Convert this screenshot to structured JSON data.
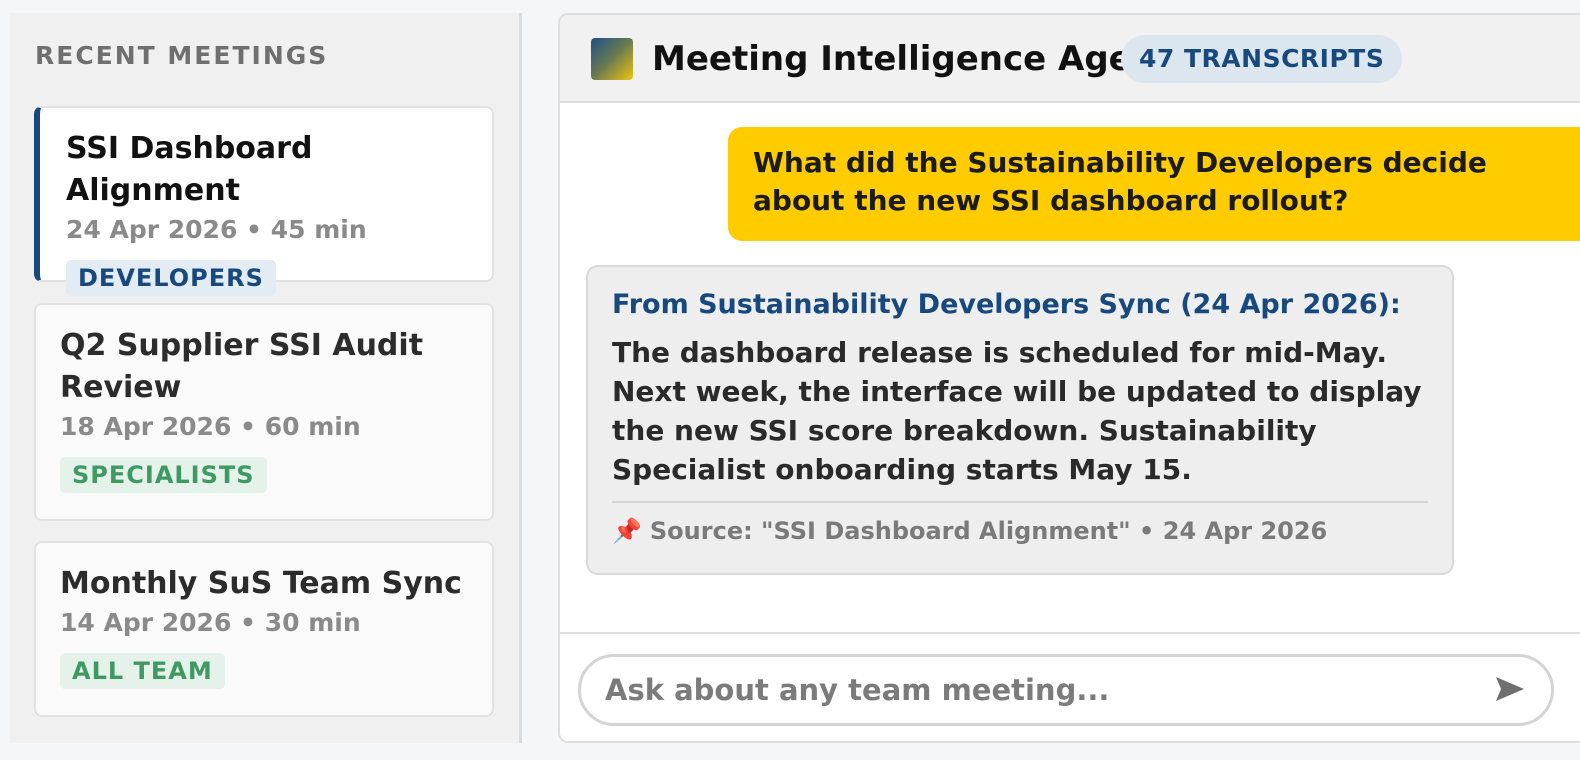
{
  "sidebar": {
    "title": "RECENT MEETINGS",
    "meetings": [
      {
        "title": "SSI Dashboard Alignment",
        "meta": "24 Apr 2026 • 45 min",
        "tag": "DEVELOPERS",
        "active": true
      },
      {
        "title": "Q2 Supplier SSI Audit Review",
        "meta": "18 Apr 2026 • 60 min",
        "tag": "SPECIALISTS",
        "active": false
      },
      {
        "title": "Monthly SuS Team Sync",
        "meta": "14 Apr 2026 • 30 min",
        "tag": "ALL TEAM",
        "active": false
      }
    ]
  },
  "header": {
    "title": "Meeting Intelligence Agent",
    "badge": "47 TRANSCRIPTS",
    "logo_colors": [
      "#1e4f86",
      "#f1c40f"
    ]
  },
  "chat": {
    "user_message": "What did the Sustainability Developers decide about the new SSI dashboard rollout?",
    "answer": {
      "source_heading": "From Sustainability Developers Sync (24 Apr 2026):",
      "body": "The dashboard release is scheduled for mid-May. Next week, the interface will be updated to display the new SSI score breakdown. Sustainability Specialist onboarding starts May 15.",
      "citation_icon": "pin-icon",
      "citation": "Source: \"SSI Dashboard Alignment\" • 24 Apr 2026"
    }
  },
  "input": {
    "placeholder": "Ask about any team meeting...",
    "value": "",
    "send_icon": "send-icon"
  },
  "colors": {
    "accent_blue": "#17497e",
    "accent_yellow": "#ffcc00",
    "tag_green": "#3e9a62"
  }
}
